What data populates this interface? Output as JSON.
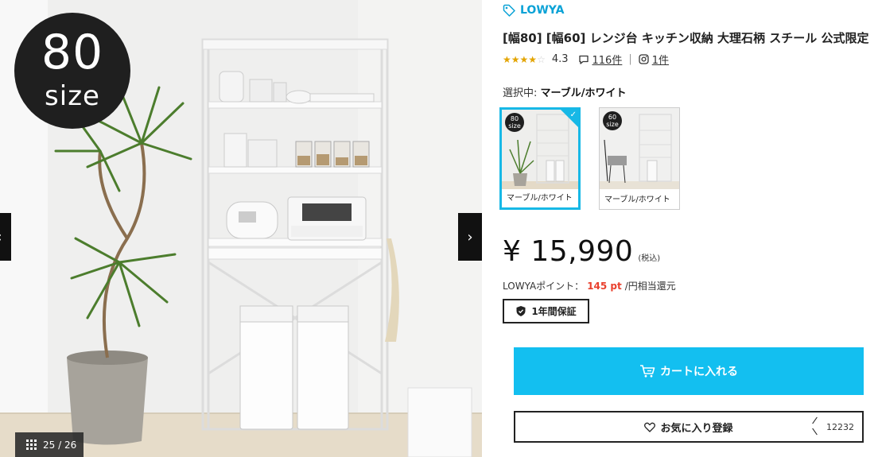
{
  "gallery": {
    "size_badge": {
      "number": "80",
      "unit": "size"
    },
    "counter": "25 / 26",
    "prev_icon": "chevron-left-icon",
    "next_icon": "chevron-right-icon",
    "prev_glyph": "‹",
    "next_glyph": "›"
  },
  "brand": {
    "name": "LOWYA",
    "icon": "tag-icon"
  },
  "product": {
    "title": "[幅80] [幅60] レンジ台 キッチン収納 大理石柄 スチール 公式限定",
    "rating": "4.3",
    "stars_filled": 4,
    "stars_total": 5,
    "reviews_count": "116件",
    "instagram_count": "1件",
    "divider": "|"
  },
  "selection": {
    "label": "選択中:",
    "value": "マーブル/ホワイト",
    "variants": [
      {
        "label": "マーブル/ホワイト",
        "badge_num": "80",
        "badge_unit": "size",
        "active": true
      },
      {
        "label": "マーブル/ホワイト",
        "badge_num": "60",
        "badge_unit": "size",
        "active": false
      }
    ]
  },
  "price": {
    "amount": "¥ 15,990",
    "tax": "(税込)"
  },
  "points": {
    "label": "LOWYAポイント：",
    "value": "145 pt",
    "suffix": "/円相当還元"
  },
  "warranty": {
    "label": "1年間保証"
  },
  "cart": {
    "label": "カートに入れる"
  },
  "favorite": {
    "label": "お気に入り登録",
    "count": "12232"
  },
  "colors": {
    "accent": "#13bff0",
    "brand": "#0aa2d6",
    "points": "#e9412e",
    "star": "#e3a400"
  }
}
